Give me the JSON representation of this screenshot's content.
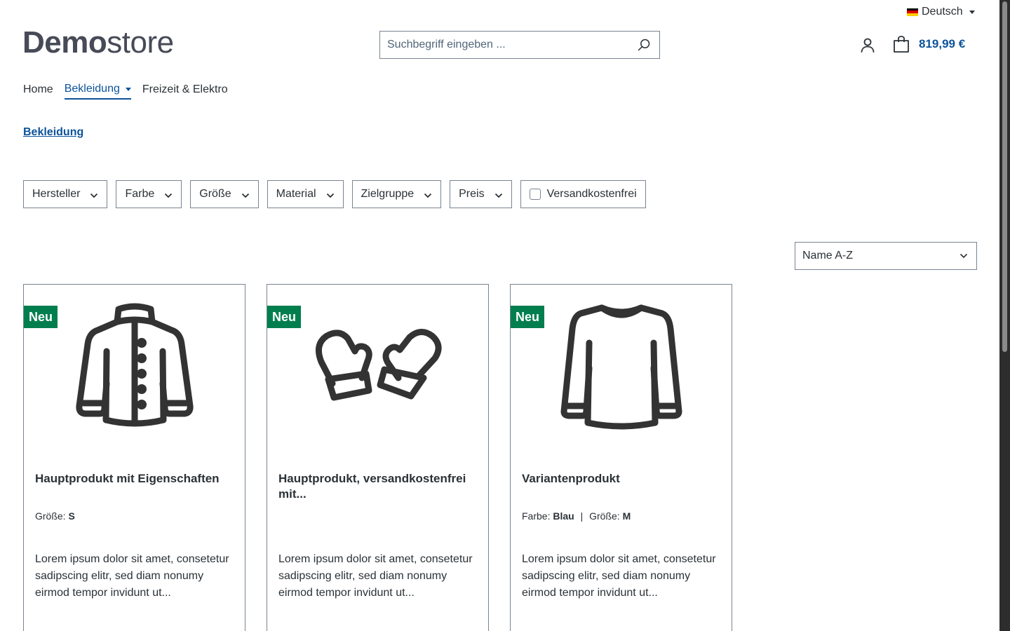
{
  "language": {
    "label": "Deutsch",
    "flag_colors": [
      "#000000",
      "#dd0000",
      "#ffce00"
    ]
  },
  "logo": {
    "bold": "Demo",
    "light": "store"
  },
  "search": {
    "placeholder": "Suchbegriff eingeben ..."
  },
  "cart": {
    "total": "819,99 €"
  },
  "nav": {
    "items": [
      {
        "label": "Home",
        "active": false
      },
      {
        "label": "Bekleidung",
        "active": true
      },
      {
        "label": "Freizeit & Elektro",
        "active": false
      }
    ]
  },
  "breadcrumb": {
    "label": "Bekleidung"
  },
  "filters": {
    "items": [
      "Hersteller",
      "Farbe",
      "Größe",
      "Material",
      "Zielgruppe",
      "Preis"
    ],
    "shipping_free": "Versandkostenfrei"
  },
  "sorting": {
    "selected": "Name A-Z"
  },
  "products": [
    {
      "badge": "Neu",
      "icon": "jacket-icon",
      "title": "Hauptprodukt mit Eigenschaften",
      "props": [
        {
          "key": "Größe:",
          "value": "S"
        }
      ],
      "description": "Lorem ipsum dolor sit amet, consetetur sadipscing elitr, sed diam nonumy eirmod tempor invidunt ut..."
    },
    {
      "badge": "Neu",
      "icon": "mittens-icon",
      "title": "Hauptprodukt, versandkostenfrei mit...",
      "props": [],
      "description": "Lorem ipsum dolor sit amet, consetetur sadipscing elitr, sed diam nonumy eirmod tempor invidunt ut..."
    },
    {
      "badge": "Neu",
      "icon": "sweater-icon",
      "title": "Variantenprodukt",
      "props": [
        {
          "key": "Farbe:",
          "value": "Blau"
        },
        {
          "key": "Größe:",
          "value": "M"
        }
      ],
      "description": "Lorem ipsum dolor sit amet, consetetur sadipscing elitr, sed diam nonumy eirmod tempor invidunt ut..."
    }
  ],
  "colors": {
    "primary": "#0b539b",
    "badge": "#007e4e",
    "text": "#2b3136",
    "border": "#798490"
  }
}
